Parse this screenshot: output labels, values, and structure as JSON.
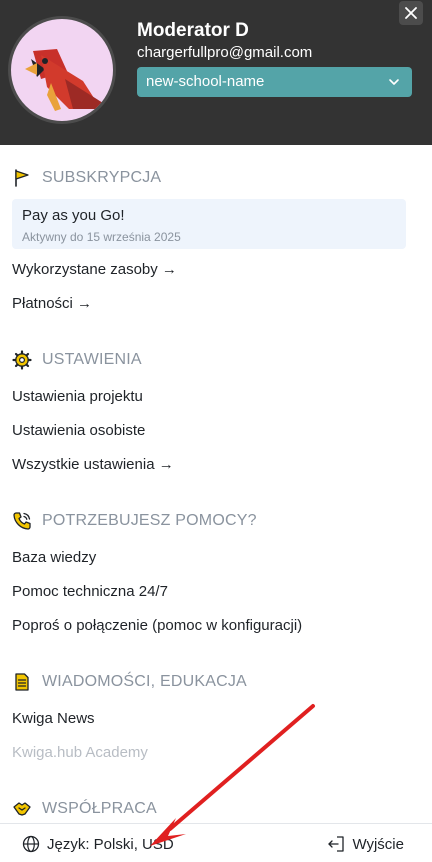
{
  "header": {
    "user_name": "Moderator D",
    "user_email": "chargerfullpro@gmail.com",
    "school_select": {
      "value": "new-school-name"
    },
    "avatar_icon": "cardinal-bird-avatar",
    "close_icon": "close-icon"
  },
  "subscription": {
    "title": "SUBSKRYPCJA",
    "icon": "flag-icon",
    "plan_name": "Pay as you Go!",
    "plan_active_until": "Aktywny do 15 września 2025",
    "links": [
      "Wykorzystane zasoby →",
      "Płatności →"
    ]
  },
  "settings": {
    "title": "USTAWIENIA",
    "icon": "gear-icon",
    "links": [
      "Ustawienia projektu",
      "Ustawienia osobiste",
      "Wszystkie ustawienia →"
    ]
  },
  "help": {
    "title": "POTRZEBUJESZ POMOCY?",
    "icon": "phone-icon",
    "links": [
      "Baza wiedzy",
      "Pomoc techniczna 24/7",
      "Poproś o połączenie (pomoc w konfiguracji)"
    ]
  },
  "news": {
    "title": "WIADOMOŚCI, EDUKACJA",
    "icon": "document-icon",
    "links": [
      "Kwiga News",
      "Kwiga.hub Academy"
    ]
  },
  "cooperation": {
    "title": "WSPÓŁPRACA",
    "icon": "handshake-icon"
  },
  "footer": {
    "language_label": "Język: Polski, USD",
    "language_icon": "globe-icon",
    "logout_label": "Wyjście",
    "logout_icon": "logout-icon"
  },
  "colors": {
    "header_bg": "#333333",
    "accent_teal": "#54a4a8",
    "section_title": "#8a939e",
    "icon_yellow": "#f2c500",
    "annotation_arrow": "#e02020"
  }
}
